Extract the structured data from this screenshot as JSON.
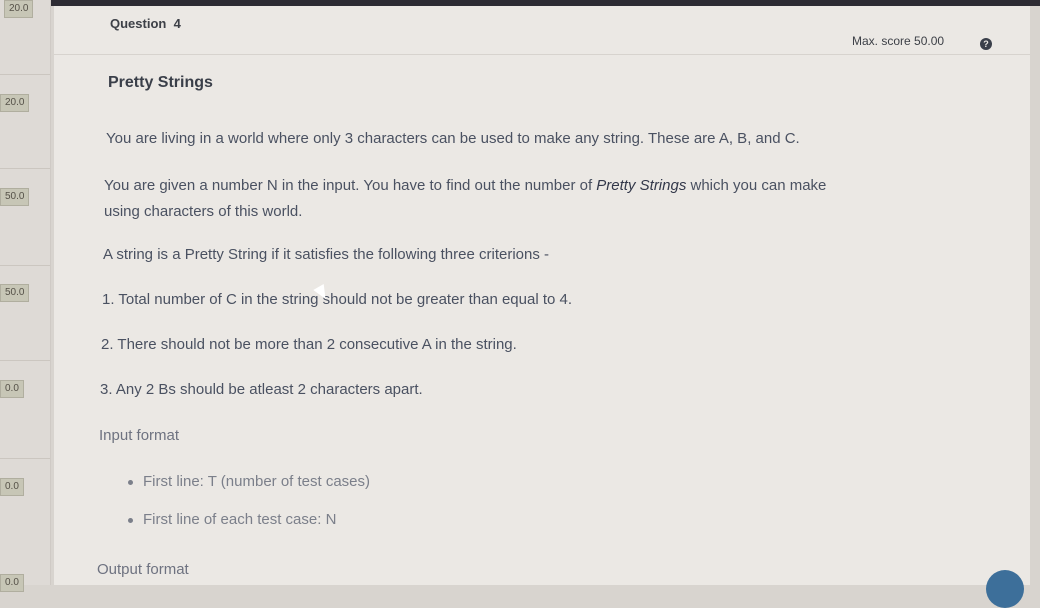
{
  "sidebar": {
    "scores": [
      "20.0",
      "20.0",
      "50.0",
      "50.0",
      "0.0",
      "0.0",
      "0.0"
    ]
  },
  "question": {
    "label": "Question",
    "number": "4",
    "max_score": "Max. score 50.00",
    "help_icon": "?"
  },
  "problem": {
    "title": "Pretty Strings",
    "p1": "You are living in a world where only 3 characters can be used to make any string. These are A, B, and C.",
    "p2_part1": "You are given a number N in the input. You have to find out the number of ",
    "p2_em": "Pretty Strings",
    "p2_part2": " which you can make",
    "p2_line2": "using characters of this world.",
    "p3": "A string is a Pretty String if it satisfies the following three criterions -",
    "c1": "1. Total number of C in the string should not be greater than equal to 4.",
    "c2": "2. There should not be more than 2 consecutive A in the string.",
    "c3": "3. Any 2 Bs should be atleast 2 characters apart.",
    "input_heading": "Input format",
    "input_b1": "First line: T (number of test cases)",
    "input_b2": "First line of each test case: N",
    "output_heading": "Output format"
  },
  "colors": {
    "page_bg": "#ebe8e4",
    "text": "#4a5161",
    "badge": "#c7c6b6"
  }
}
